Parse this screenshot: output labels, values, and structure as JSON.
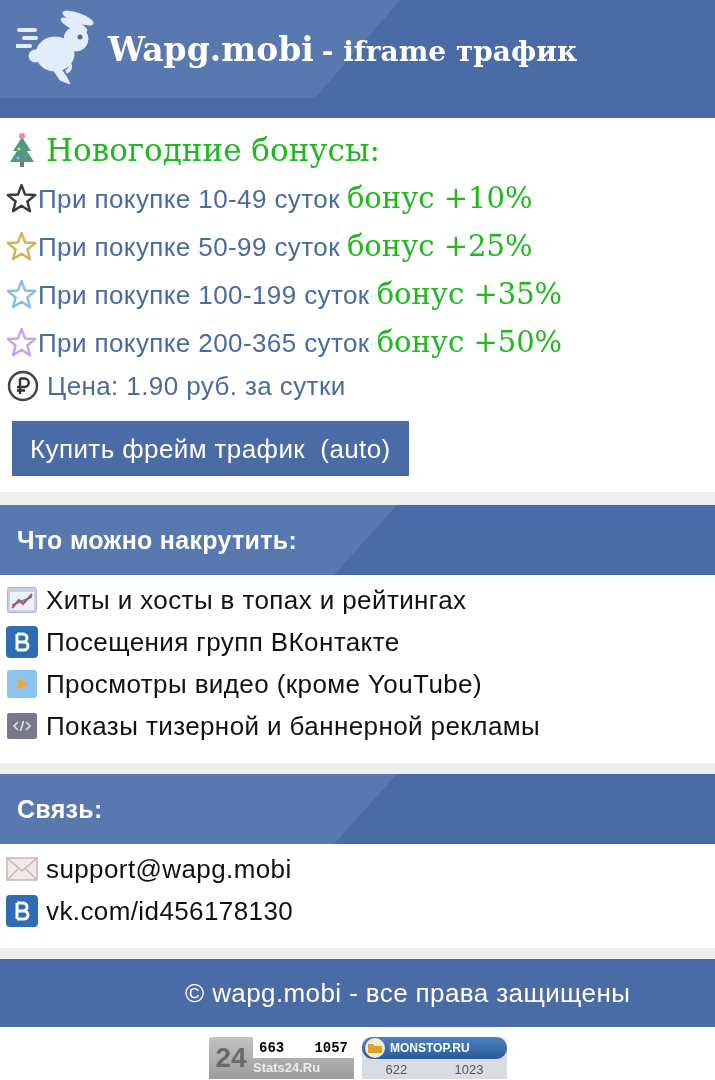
{
  "header": {
    "logo_text": "Wapg.mobi",
    "tagline": "- iframe трафик"
  },
  "promo": {
    "title": "Новогодние бонусы:",
    "bonuses": [
      {
        "condition": "При покупке 10-49 суток",
        "bonus": "бонус +10%",
        "color": "#3a3a3a"
      },
      {
        "condition": "При покупке 50-99 суток",
        "bonus": "бонус +25%",
        "color": "#d2b25a"
      },
      {
        "condition": "При покупке 100-199 суток",
        "bonus": "бонус +35%",
        "color": "#8cbbe8"
      },
      {
        "condition": "При покупке 200-365 суток",
        "bonus": "бонус +50%",
        "color": "#c9a2ee"
      }
    ],
    "price": "Цена: 1.90 руб. за сутки",
    "buy_button": "Купить фрейм трафик  (auto)"
  },
  "sections": [
    {
      "title": "Что можно накрутить:",
      "items": [
        {
          "kind": "chart",
          "text": "Хиты и хосты в топах и рейтингах"
        },
        {
          "kind": "vk",
          "text": "Посещения групп ВКонтакте"
        },
        {
          "kind": "video",
          "text": "Просмотры видео (кроме YouTube)"
        },
        {
          "kind": "code",
          "text": "Показы тизерной и баннерной рекламы"
        }
      ]
    },
    {
      "title": "Связь:",
      "items": [
        {
          "kind": "mail",
          "text": "support@wapg.mobi"
        },
        {
          "kind": "vk",
          "text": "vk.com/id456178130"
        }
      ]
    }
  ],
  "footer": {
    "copyright": "© wapg.mobi - все права защищены"
  },
  "counters": [
    {
      "kind": "stats",
      "logo": "24",
      "values": [
        "663",
        "1057"
      ],
      "caption": "Stats24.Ru"
    },
    {
      "kind": "rating",
      "caption": "MONSTOP.RU",
      "values": [
        "622",
        "1023"
      ]
    }
  ]
}
